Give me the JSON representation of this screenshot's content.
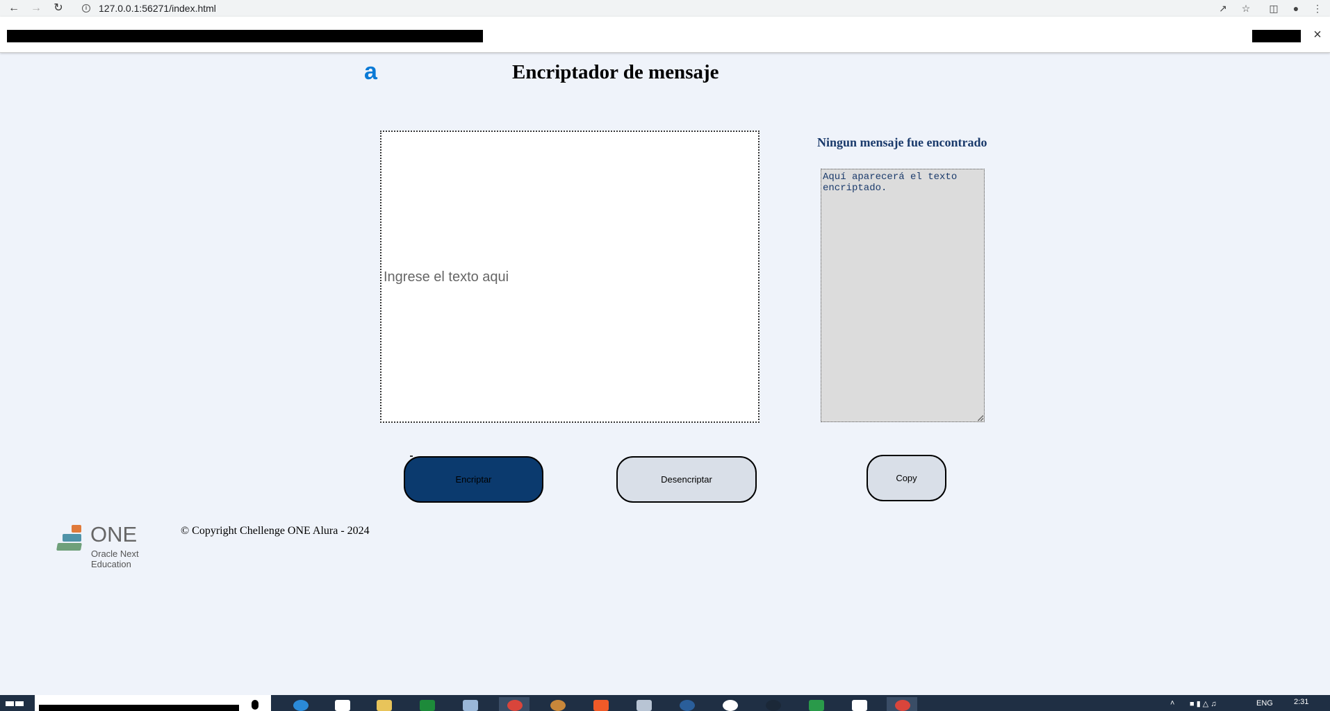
{
  "browser": {
    "url": "127.0.0.1:56271/index.html",
    "back_icon": "arrow-left-icon",
    "forward_icon": "arrow-right-icon",
    "reload_icon": "reload-icon"
  },
  "page": {
    "logo_glyph": "a",
    "title": "Encriptador de mensaje",
    "input_placeholder": "Ingrese el texto aqui",
    "status_heading": "Ningun mensaje fue encontrado",
    "output_placeholder": "Aquí aparecerá el texto encriptado.",
    "buttons": {
      "encrypt": "Encriptar",
      "decrypt": "Desencriptar",
      "copy": "Copy"
    },
    "footer": {
      "logo_text": "ONE",
      "logo_sub1": "Oracle Next",
      "logo_sub2": "Education",
      "copyright": "© Copyright Chellenge ONE Alura - 2024"
    }
  },
  "taskbar": {
    "language": "ENG",
    "time": "2:31"
  },
  "colors": {
    "page_background": "#eff3fa",
    "encrypt_button": "#0b3a6e",
    "secondary_button": "#d9dfe8",
    "heading_blue": "#1a3a6b",
    "logo_blue": "#0a7ad6"
  }
}
